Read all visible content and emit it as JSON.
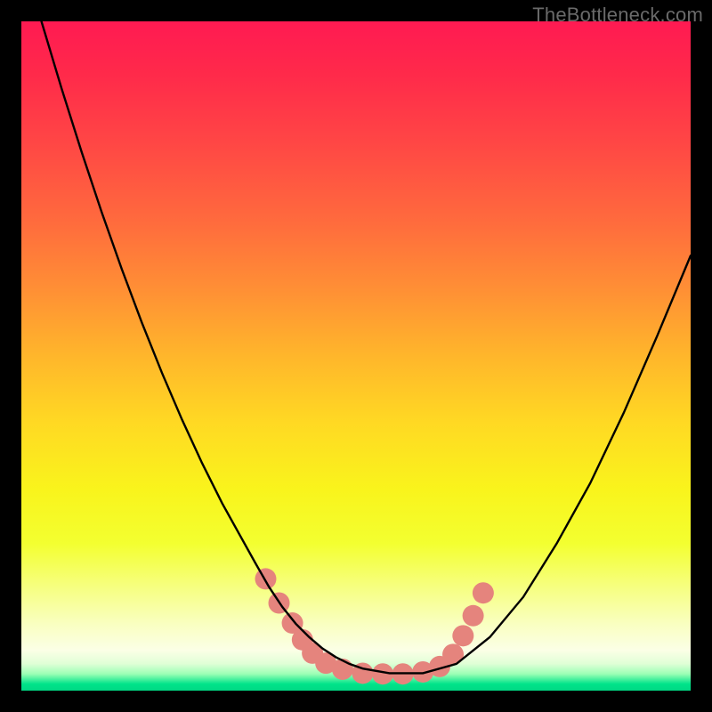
{
  "watermark": {
    "text": "TheBottleneck.com"
  },
  "colors": {
    "background": "#000000",
    "curve_stroke": "#000000",
    "marker_fill": "#e5847d",
    "gradient_stops": [
      "#ff1a52",
      "#ff2a4a",
      "#ff4645",
      "#ff6b3d",
      "#ff8f35",
      "#ffb62b",
      "#ffd923",
      "#f9f41c",
      "#f3ff30",
      "#f6ff7a",
      "#f9ffc0",
      "#fbffe6",
      "#e0ffd6",
      "#9cffb5",
      "#00e48a",
      "#00d884"
    ]
  },
  "chart_data": {
    "type": "line",
    "title": "",
    "xlabel": "",
    "ylabel": "",
    "xlim": [
      0,
      100
    ],
    "ylim": [
      0,
      100
    ],
    "series": [
      {
        "name": "bottleneck-curve",
        "x": [
          3,
          6,
          9,
          12,
          15,
          18,
          21,
          24,
          27,
          30,
          32.5,
          35,
          37,
          39,
          41,
          43,
          45,
          47,
          49,
          51,
          55,
          60,
          65,
          70,
          75,
          80,
          85,
          90,
          95,
          100
        ],
        "y": [
          100,
          90,
          80.5,
          71.5,
          63,
          55,
          47.5,
          40.5,
          34,
          28,
          23.5,
          19,
          15.5,
          12.5,
          10,
          8,
          6.3,
          5,
          4,
          3.3,
          2.6,
          2.6,
          4,
          8,
          14,
          22,
          31,
          41.5,
          53,
          65
        ]
      }
    ],
    "markers": [
      {
        "x": 36.5,
        "y": 16.7,
        "r": 12
      },
      {
        "x": 38.5,
        "y": 13.1,
        "r": 12
      },
      {
        "x": 40.5,
        "y": 10.1,
        "r": 12
      },
      {
        "x": 42,
        "y": 7.6,
        "r": 12
      },
      {
        "x": 43.5,
        "y": 5.6,
        "r": 12
      },
      {
        "x": 45.5,
        "y": 4.1,
        "r": 12
      },
      {
        "x": 48,
        "y": 3.2,
        "r": 12
      },
      {
        "x": 51,
        "y": 2.6,
        "r": 12
      },
      {
        "x": 54,
        "y": 2.5,
        "r": 12
      },
      {
        "x": 57,
        "y": 2.5,
        "r": 12
      },
      {
        "x": 60,
        "y": 2.8,
        "r": 12
      },
      {
        "x": 62.5,
        "y": 3.6,
        "r": 12
      },
      {
        "x": 64.5,
        "y": 5.4,
        "r": 12
      },
      {
        "x": 66,
        "y": 8.2,
        "r": 12
      },
      {
        "x": 67.5,
        "y": 11.2,
        "r": 12
      },
      {
        "x": 69,
        "y": 14.6,
        "r": 12
      }
    ]
  }
}
